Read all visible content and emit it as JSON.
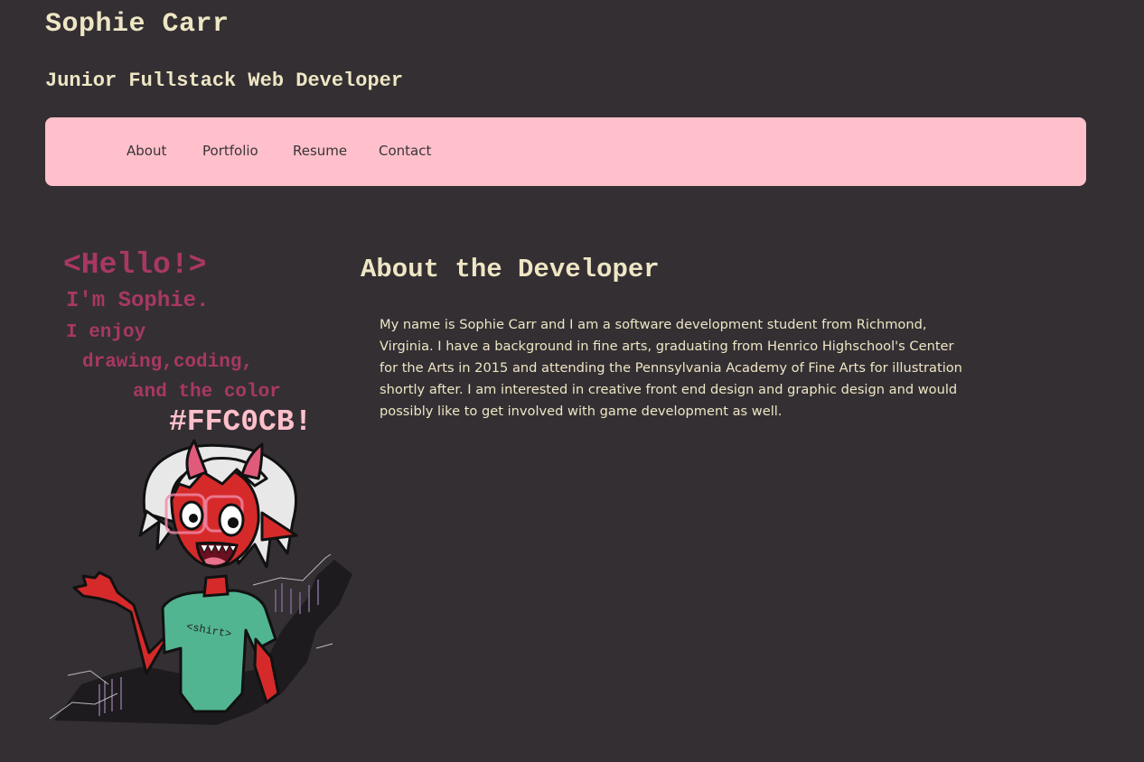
{
  "header": {
    "name": "Sophie Carr",
    "role": "Junior Fullstack Web Developer"
  },
  "nav": {
    "items": [
      "About",
      "Portfolio",
      "Resume",
      "Contact"
    ]
  },
  "about": {
    "title": "About the Developer",
    "body": "My name is Sophie Carr and I am a software development student from Richmond, Virginia. I have a background in fine arts, graduating from Henrico Highschool's Center for the Arts in 2015 and attending the Pennsylvania Academy of Fine Arts for illustration shortly after. I am interested in creative front end design and graphic design and would possibly like to get involved with game development as well."
  },
  "illustration": {
    "lines": [
      "<Hello!>",
      "I'm Sophie.",
      "I enjoy",
      "drawing,coding,",
      "and the color",
      "#FFC0CB!"
    ],
    "shirt_text": "<shirt>"
  },
  "colors": {
    "background": "#342f33",
    "accent_pink": "#ffc0cb",
    "cream_text": "#eee6c4",
    "magenta_text": "#a83863"
  }
}
